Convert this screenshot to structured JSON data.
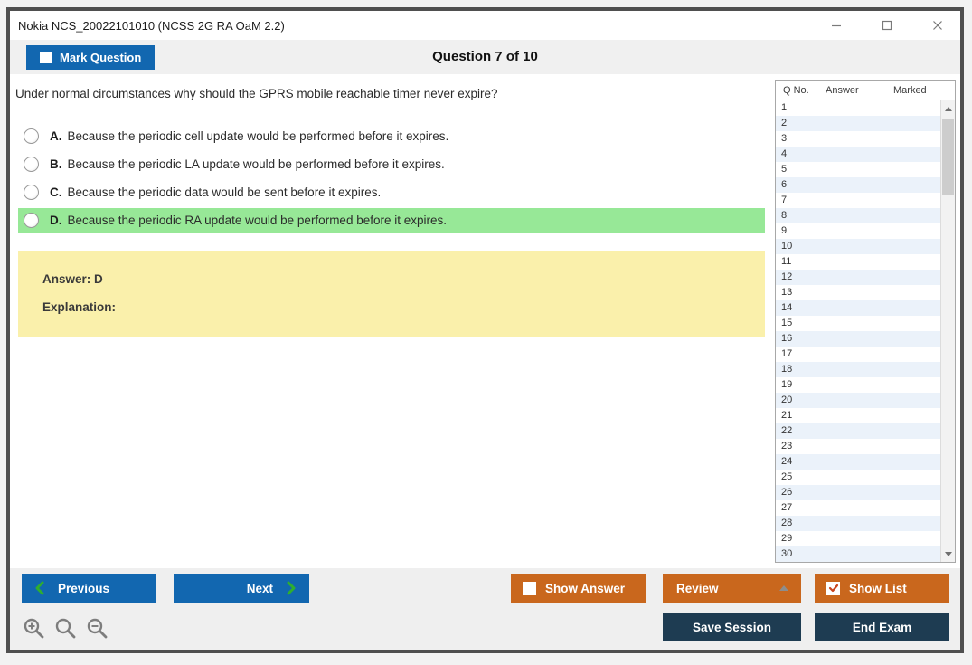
{
  "window": {
    "title": "Nokia NCS_20022101010 (NCSS 2G RA OaM 2.2)"
  },
  "header": {
    "mark_question": "Mark Question",
    "counter": "Question 7 of 10"
  },
  "question": {
    "text": "Under normal circumstances why should the GPRS mobile reachable timer never expire?",
    "options": [
      {
        "letter": "A.",
        "text": "Because the periodic cell update would be performed before it expires.",
        "highlighted": false,
        "selected": false
      },
      {
        "letter": "B.",
        "text": "Because the periodic LA update would be performed before it expires.",
        "highlighted": false,
        "selected": false
      },
      {
        "letter": "C.",
        "text": "Because the periodic data would be sent before it expires.",
        "highlighted": false,
        "selected": false
      },
      {
        "letter": "D.",
        "text": "Because the periodic RA update would be performed before it expires.",
        "highlighted": true,
        "selected": false
      }
    ],
    "answer": "Answer: D",
    "explanation": "Explanation:"
  },
  "question_list": {
    "columns": [
      "Q No.",
      "Answer",
      "Marked"
    ],
    "q_numbers": [
      "1",
      "2",
      "3",
      "4",
      "5",
      "6",
      "7",
      "8",
      "9",
      "10",
      "11",
      "12",
      "13",
      "14",
      "15",
      "16",
      "17",
      "18",
      "19",
      "20",
      "21",
      "22",
      "23",
      "24",
      "25",
      "26",
      "27",
      "28",
      "29",
      "30"
    ]
  },
  "footer": {
    "previous": "Previous",
    "next": "Next",
    "show_answer": "Show Answer",
    "review": "Review",
    "show_list": "Show List",
    "save_session": "Save Session",
    "end_exam": "End Exam",
    "show_answer_checked": false,
    "show_list_checked": true
  },
  "colors": {
    "accent_blue": "#1267b0",
    "accent_orange": "#c9671d",
    "dark_navy": "#1e3c52",
    "highlight_green": "#97e897",
    "answer_yellow": "#faf0ab",
    "row_alt_blue": "#ebf2fa",
    "chevron_green": "#2fae2f"
  }
}
